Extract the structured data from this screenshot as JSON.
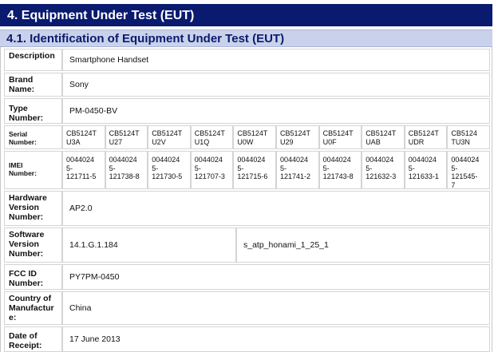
{
  "headings": {
    "section": "4. Equipment Under Test (EUT)",
    "subsection": "4.1. Identification of Equipment Under Test (EUT)"
  },
  "rows": {
    "description": {
      "label": "Description",
      "value": "Smartphone Handset"
    },
    "brand": {
      "label_1": "Brand",
      "label_2": "Name:",
      "value": "Sony"
    },
    "type": {
      "label_1": "Type",
      "label_2": "Number:",
      "value": "PM-0450-BV"
    },
    "serial": {
      "label_1": "Serial",
      "label_2": "Number:",
      "values": [
        [
          "CB5124T",
          "U3A"
        ],
        [
          "CB5124T",
          "U27"
        ],
        [
          "CB5124T",
          "U2V"
        ],
        [
          "CB5124T",
          "U1Q"
        ],
        [
          "CB5124T",
          "U0W"
        ],
        [
          "CB5124T",
          "U29"
        ],
        [
          "CB5124T",
          "U0F"
        ],
        [
          "CB5124T",
          "UAB"
        ],
        [
          "CB5124T",
          "UDR"
        ],
        [
          "CB5124",
          "TU3N"
        ]
      ]
    },
    "imei": {
      "label_1": "IMEI",
      "label_2": "Number:",
      "values": [
        [
          "0044024",
          "5-",
          "121711-5"
        ],
        [
          "0044024",
          "5-",
          "121738-8"
        ],
        [
          "0044024",
          "5-",
          "121730-5"
        ],
        [
          "0044024",
          "5-",
          "121707-3"
        ],
        [
          "0044024",
          "5-",
          "121715-6"
        ],
        [
          "0044024",
          "5-",
          "121741-2"
        ],
        [
          "0044024",
          "5-",
          "121743-8"
        ],
        [
          "0044024",
          "5-",
          "121632-3"
        ],
        [
          "0044024",
          "5-",
          "121633-1"
        ],
        [
          "0044024",
          "5-",
          "121545-",
          "7"
        ]
      ]
    },
    "hardware": {
      "label_1": "Hardware",
      "label_2": "Version",
      "label_3": "Number:",
      "value": "AP2.0"
    },
    "software": {
      "label_1": "Software",
      "label_2": "Version",
      "label_3": "Number:",
      "value": "14.1.G.1.184",
      "value_2": "s_atp_honami_1_25_1"
    },
    "fcc": {
      "label_1": "FCC ID",
      "label_2": "Number:",
      "value": "PY7PM-0450"
    },
    "country": {
      "label_1": "Country of",
      "label_2": "Manufactur",
      "label_3": "e:",
      "value": "China"
    },
    "date": {
      "label_1": "Date of",
      "label_2": "Receipt:",
      "value": "17 June 2013"
    }
  }
}
